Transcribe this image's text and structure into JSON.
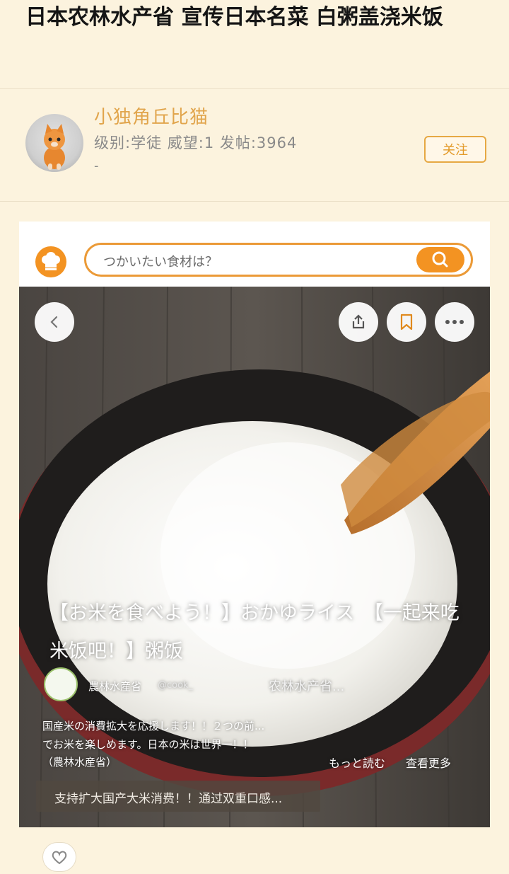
{
  "post": {
    "title": "日本农林水产省 宣传日本名菜 白粥盖浇米饭"
  },
  "author": {
    "name": "小独角丘比猫",
    "meta": "级别:学徒 威望:1 发帖:3964",
    "extra": "-",
    "follow_label": "关注"
  },
  "app_screenshot": {
    "search_placeholder": "つかいたい食材は？",
    "recipe_title": "【お米を食べよう！】おかゆライス　【一起来吃米饭吧！】粥饭",
    "source_name": "農林水産省",
    "source_handle": "@cook_",
    "source_translated": "农林水产省...",
    "description": [
      "国産米の消費拡大を応援します！！２つの前...",
      "でお米を楽しめます。日本の米は世界一！！",
      "（農林水産省）"
    ],
    "read_more_jp": "もっと読む",
    "read_more_cn": "查看更多",
    "translation_snippet": "支持扩大国产大米消费！！通过双重口感..."
  },
  "colors": {
    "page_bg": "#fcf3de",
    "accent": "#f39322",
    "author_name": "#e1a54c"
  },
  "icons": [
    "cat-avatar",
    "chef-hat-icon",
    "search-icon",
    "back-icon",
    "share-icon",
    "bookmark-icon",
    "more-icon",
    "like-icon"
  ]
}
